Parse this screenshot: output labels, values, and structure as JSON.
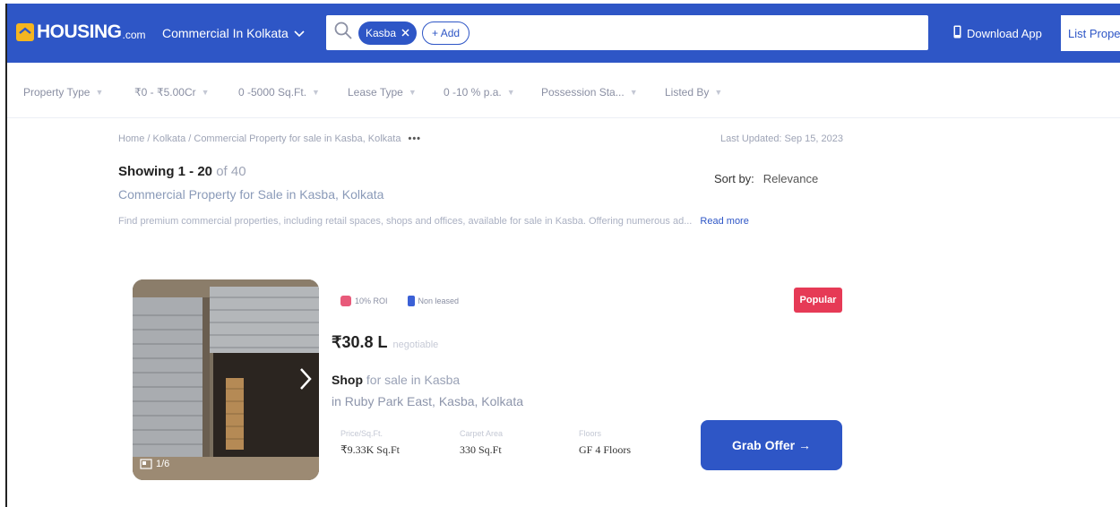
{
  "header": {
    "logo_text": "HOUSING",
    "logo_suffix": ".com",
    "city_menu": "Commercial In Kolkata",
    "search": {
      "chip": "Kasba",
      "add_label": "+ Add"
    },
    "download_label": "Download App",
    "list_property_label": "List Proper"
  },
  "filters": [
    {
      "label": "Property Type"
    },
    {
      "label": "₹0 - ₹5.00Cr"
    },
    {
      "label": "0 -5000 Sq.Ft."
    },
    {
      "label": "Lease Type"
    },
    {
      "label": "0 -10 % p.a."
    },
    {
      "label": "Possession Sta..."
    },
    {
      "label": "Listed By"
    }
  ],
  "breadcrumb": {
    "text": "Home / Kolkata / Commercial Property for sale in Kasba, Kolkata",
    "more": "•••"
  },
  "last_updated": "Last Updated: Sep 15, 2023",
  "results": {
    "showing": "Showing 1 - 20",
    "total": "of 40",
    "sort_label": "Sort by:",
    "sort_value": "Relevance",
    "subtitle": "Commercial Property for Sale in Kasba, Kolkata",
    "description": "Find premium commercial properties, including retail spaces, shops and offices, available for sale in Kasba. Offering numerous ad...",
    "read_more": "Read more"
  },
  "listing": {
    "photo_count": "1/6",
    "tag_roi": "10% ROI",
    "tag_lease": "Non leased",
    "badge": "Popular",
    "price": "₹30.8 L",
    "price_note": "negotiable",
    "title_bold": "Shop",
    "title_rest": " for sale in Kasba",
    "location": "in Ruby Park East, Kasba, Kolkata",
    "facts": [
      {
        "key": "Price/Sq.Ft.",
        "value": "₹9.33K Sq.Ft"
      },
      {
        "key": "Carpet Area",
        "value": "330 Sq.Ft"
      },
      {
        "key": "Floors",
        "value": "GF 4 Floors"
      }
    ],
    "cta": "Grab Offer →"
  },
  "colors": {
    "brand": "#2e56c6",
    "accent": "#f5b51f",
    "badge": "#e63a56"
  }
}
